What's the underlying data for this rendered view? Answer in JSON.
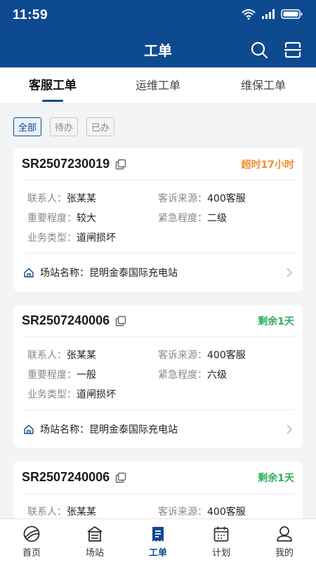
{
  "status_bar": {
    "time": "11:59"
  },
  "header": {
    "title": "工单"
  },
  "tabs": [
    {
      "label": "客服工单",
      "active": true
    },
    {
      "label": "运维工单",
      "active": false
    },
    {
      "label": "维保工单",
      "active": false
    }
  ],
  "filters": [
    {
      "label": "全部",
      "active": true
    },
    {
      "label": "待办",
      "active": false
    },
    {
      "label": "已办",
      "active": false
    }
  ],
  "labels": {
    "contact": "联系人：",
    "source": "客诉来源：",
    "importance": "重要程度：",
    "urgency": "紧急程度：",
    "biz_type": "业务类型：",
    "station": "场站名称："
  },
  "orders": [
    {
      "no": "SR2507230019",
      "status": "超时17小时",
      "status_color": "#f08c2a",
      "contact": "张某某",
      "source": "400客服",
      "importance": "较大",
      "urgency": "二级",
      "biz_type": "道闸损坏",
      "station": "昆明金泰国际充电站"
    },
    {
      "no": "SR2507240006",
      "status": "剩余1天",
      "status_color": "#2fae5e",
      "contact": "张某某",
      "source": "400客服",
      "importance": "一般",
      "urgency": "六级",
      "biz_type": "道闸损坏",
      "station": "昆明金泰国际充电站"
    },
    {
      "no": "SR2507240006",
      "status": "剩余1天",
      "status_color": "#2fae5e",
      "contact": "张某某",
      "source": "400客服",
      "importance": "",
      "urgency": "",
      "biz_type": "",
      "station": ""
    }
  ],
  "tabbar": [
    {
      "label": "首页",
      "icon": "home-globe-icon",
      "active": false
    },
    {
      "label": "场站",
      "icon": "station-icon",
      "active": false
    },
    {
      "label": "工单",
      "icon": "work-order-icon",
      "active": true
    },
    {
      "label": "计划",
      "icon": "calendar-icon",
      "active": false
    },
    {
      "label": "我的",
      "icon": "user-icon",
      "active": false
    }
  ],
  "colors": {
    "brand": "#0e4a8f",
    "overdue": "#f08c2a",
    "remaining": "#2fae5e"
  }
}
